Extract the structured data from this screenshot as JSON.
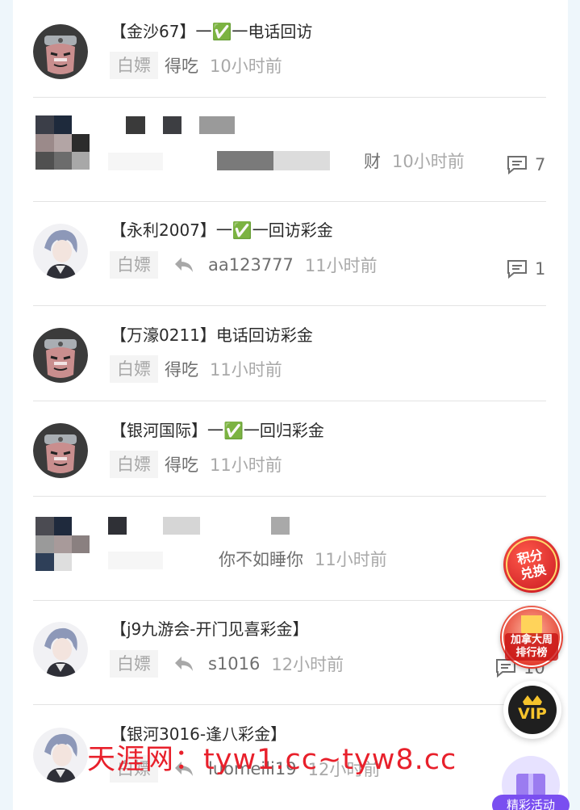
{
  "posts": [
    {
      "title": "【金沙67】一✅一电话回访",
      "tag": "白嫖",
      "author": "得吃",
      "time": "10小时前",
      "comments": "",
      "avatar": "ninja-avatar"
    },
    {
      "title": "",
      "tag": "",
      "author": "财",
      "time": "10小时前",
      "comments": "7",
      "avatar": "pixelated-avatar"
    },
    {
      "title": "【永利2007】一✅一回访彩金",
      "tag": "白嫖",
      "author": "aa123777",
      "time": "11小时前",
      "comments": "1",
      "avatar": "anime-avatar"
    },
    {
      "title": "【万濠0211】电话回访彩金",
      "tag": "白嫖",
      "author": "得吃",
      "time": "11小时前",
      "comments": "",
      "avatar": "ninja-avatar"
    },
    {
      "title": "【银河国际】一✅一回归彩金",
      "tag": "白嫖",
      "author": "得吃",
      "time": "11小时前",
      "comments": "",
      "avatar": "ninja-avatar"
    },
    {
      "title": "",
      "tag": "",
      "author": "你不如睡你",
      "time": "11小时前",
      "comments": "",
      "avatar": "pixelated-avatar"
    },
    {
      "title": "【j9九游会-开门见喜彩金】",
      "tag": "白嫖",
      "author": "s1016",
      "time": "12小时前",
      "comments": "10",
      "avatar": "anime-avatar"
    },
    {
      "title": "【银河3016-逢八彩金】",
      "tag": "白嫖",
      "author": "luomeili19",
      "time": "12小时前",
      "comments": "",
      "avatar": "anime-avatar"
    }
  ],
  "floating": {
    "points_exchange": "积分兑换",
    "ranking": "加拿大周排行榜",
    "vip": "VIP",
    "event": "精彩活动"
  },
  "watermark": {
    "site": "天涯网：",
    "url": "tyw1.cc~tyw8.cc"
  },
  "colors": {
    "accent_red": "#e8202b",
    "tag_bg": "#f4f4f4",
    "vip_gold": "#f6c42c"
  }
}
